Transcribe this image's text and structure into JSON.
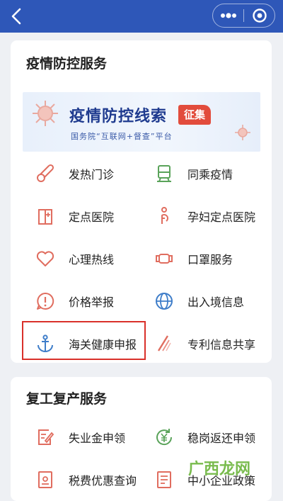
{
  "colors": {
    "nav_bg": "#2e57b8",
    "icon_red": "#e06d5f",
    "icon_green": "#5aa35a",
    "icon_blue": "#3e7dc9",
    "highlight": "#d9302a"
  },
  "section1": {
    "title": "疫情防控服务",
    "banner": {
      "title": "疫情防控线索",
      "badge": "征集",
      "subtitle": "国务院“互联网+督查”平台"
    },
    "items": [
      {
        "label": "发热门诊",
        "icon": "thermometer-icon"
      },
      {
        "label": "同乘疫情",
        "icon": "train-icon"
      },
      {
        "label": "定点医院",
        "icon": "hospital-icon"
      },
      {
        "label": "孕妇定点医院",
        "icon": "pregnant-icon"
      },
      {
        "label": "心理热线",
        "icon": "heart-icon"
      },
      {
        "label": "口罩服务",
        "icon": "mask-icon"
      },
      {
        "label": "价格举报",
        "icon": "exclamation-icon"
      },
      {
        "label": "出入境信息",
        "icon": "globe-icon"
      },
      {
        "label": "海关健康申报",
        "icon": "anchor-icon"
      },
      {
        "label": "专利信息共享",
        "icon": "patent-icon"
      }
    ]
  },
  "section2": {
    "title": "复工复产服务",
    "items": [
      {
        "label": "失业金申领",
        "icon": "form-edit-icon"
      },
      {
        "label": "稳岗返还申领",
        "icon": "yuan-refresh-icon"
      },
      {
        "label": "税费优惠查询",
        "icon": "tax-doc-icon"
      },
      {
        "label": "中小企业政策",
        "icon": "policy-doc-icon"
      }
    ]
  },
  "watermark": "广西龙网"
}
